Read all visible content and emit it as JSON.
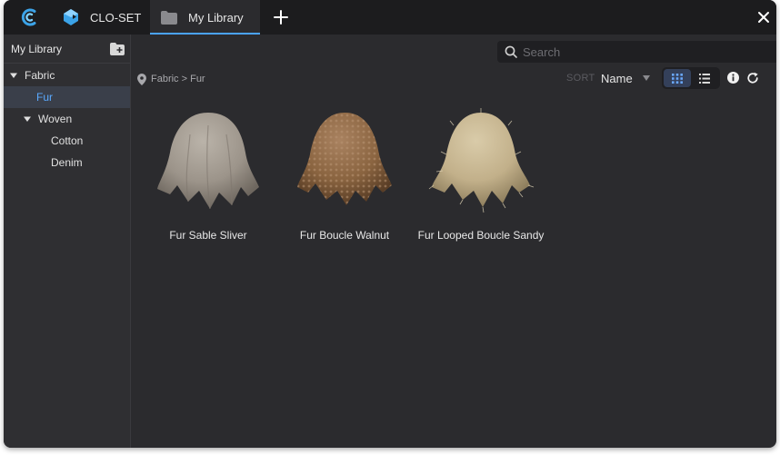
{
  "titlebar": {
    "tabs": [
      {
        "label": "CLO-SET",
        "icon": "clo-set-icon"
      },
      {
        "label": "My Library",
        "icon": "folder-icon"
      }
    ],
    "active_tab": "My Library",
    "accent": "#4aa3ff"
  },
  "sidebar": {
    "title": "My Library",
    "tree": [
      {
        "label": "Fabric",
        "expanded": true
      },
      {
        "label": "Fur",
        "selected": true
      },
      {
        "label": "Woven",
        "expanded": true
      },
      {
        "label": "Cotton"
      },
      {
        "label": "Denim"
      }
    ]
  },
  "search": {
    "placeholder": "Search",
    "value": ""
  },
  "breadcrumb": {
    "text": "Fabric > Fur"
  },
  "sort": {
    "label": "SORT",
    "value": "Name"
  },
  "view": {
    "mode": "grid"
  },
  "items": [
    {
      "name": "Fur Sable Sliver",
      "color": "#9c948a"
    },
    {
      "name": "Fur Boucle Walnut",
      "color": "#8a6440"
    },
    {
      "name": "Fur Looped Boucle Sandy",
      "color": "#c2b08a"
    }
  ]
}
